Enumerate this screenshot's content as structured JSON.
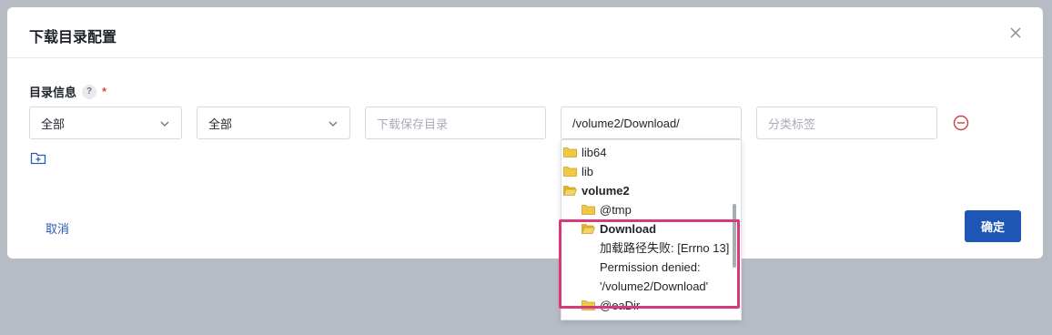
{
  "dialog": {
    "title": "下载目录配置",
    "section_label": "目录信息",
    "help_glyph": "?",
    "required_mark": "*",
    "cancel_label": "取消",
    "confirm_label": "确定"
  },
  "fields": {
    "select1_value": "全部",
    "select2_value": "全部",
    "save_dir_placeholder": "下载保存目录",
    "path_value": "/volume2/Download/",
    "tag_placeholder": "分类标签"
  },
  "tree": {
    "items": [
      {
        "label": "lib64",
        "icon": "folder-icon"
      },
      {
        "label": "lib",
        "icon": "folder-icon"
      },
      {
        "label": "volume2",
        "icon": "folder-open-icon"
      },
      {
        "label": "@tmp",
        "icon": "folder-icon"
      },
      {
        "label": "Download",
        "icon": "folder-open-icon"
      },
      {
        "label": "@eaDir",
        "icon": "folder-icon"
      }
    ],
    "error": "加载路径失败: [Errno 13] Permission denied: '/volume2/Download'"
  },
  "colors": {
    "accent": "#1e56b5",
    "highlight": "#d63a7a",
    "remove": "#d03c3c",
    "folder": "#f2c744"
  }
}
